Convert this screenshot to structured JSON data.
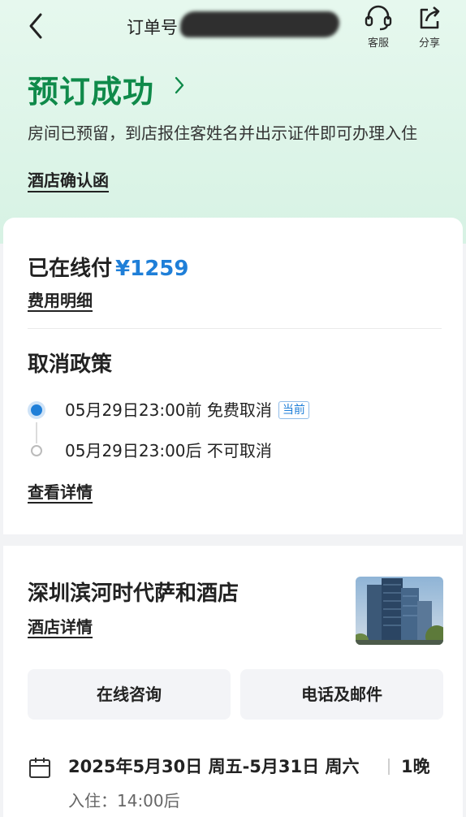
{
  "header": {
    "order_label": "订单号",
    "support_label": "客服",
    "share_label": "分享"
  },
  "status": {
    "title": "预订成功",
    "description": "房间已预留，到店报住客姓名并出示证件即可办理入住",
    "confirm_link": "酒店确认函"
  },
  "payment": {
    "paid_label": "已在线付",
    "amount": "¥1259",
    "detail_link": "费用明细"
  },
  "cancel_policy": {
    "title": "取消政策",
    "items": [
      {
        "text": "05月29日23:00前 免费取消",
        "badge": "当前"
      },
      {
        "text": "05月29日23:00后 不可取消"
      }
    ],
    "detail_link": "查看详情"
  },
  "hotel": {
    "name": "深圳滨河时代萨和酒店",
    "detail_link": "酒店详情",
    "buttons": {
      "consult": "在线咨询",
      "contact": "电话及邮件"
    }
  },
  "stay": {
    "dates": "2025年5月30日 周五-5月31日 周六",
    "nights": "1晚",
    "checkin": "入住：14:00后"
  },
  "colors": {
    "brand_green": "#0f8a4a",
    "accent_blue": "#1f7fd8"
  }
}
